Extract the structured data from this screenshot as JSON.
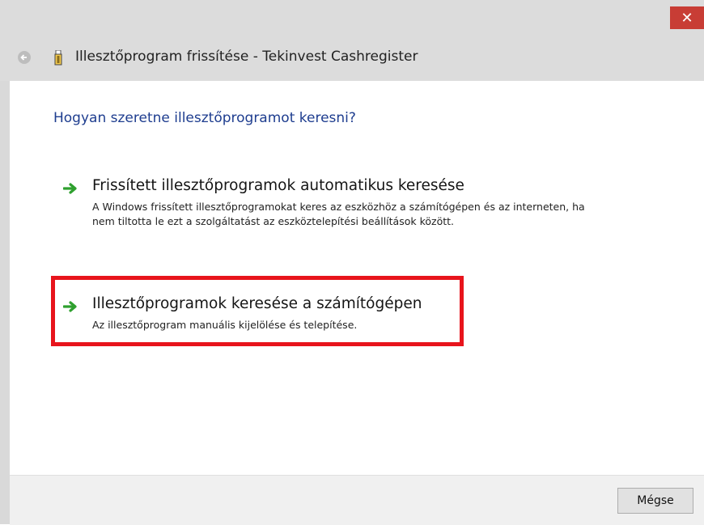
{
  "window": {
    "title": "Illesztőprogram frissítése - Tekinvest Cashregister",
    "close_glyph": "✕"
  },
  "content": {
    "question": "Hogyan szeretne illesztőprogramot keresni?",
    "options": [
      {
        "title": "Frissített illesztőprogramok automatikus keresése",
        "description": "A Windows frissített illesztőprogramokat keres az eszközhöz a számítógépen és az interneten, ha nem tiltotta le ezt a szolgáltatást az eszköztelepítési beállítások között."
      },
      {
        "title": "Illesztőprogramok keresése a számítógépen",
        "description": "Az illesztőprogram manuális kijelölése és telepítése."
      }
    ]
  },
  "footer": {
    "cancel_label": "Mégse"
  },
  "icons": {
    "back": "back-arrow-icon",
    "device": "usb-device-icon",
    "option_arrow": "green-arrow-icon"
  },
  "colors": {
    "question_text": "#1e3d8f",
    "arrow_green": "#2fa02f",
    "highlight_red": "#e8141c",
    "close_red": "#c83d35"
  }
}
